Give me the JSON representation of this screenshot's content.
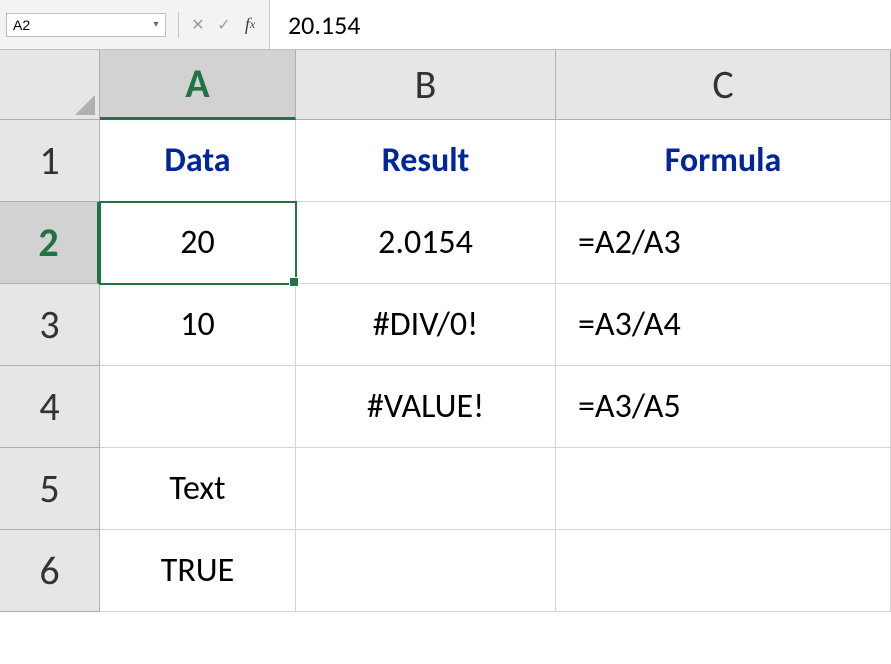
{
  "name_box": "A2",
  "formula_bar_value": "20.154",
  "columns": {
    "A": "A",
    "B": "B",
    "C": "C"
  },
  "rows": {
    "r1": "1",
    "r2": "2",
    "r3": "3",
    "r4": "4",
    "r5": "5",
    "r6": "6"
  },
  "cells": {
    "A1": "Data",
    "B1": "Result",
    "C1": "Formula",
    "A2": "20",
    "B2": "2.0154",
    "C2": "=A2/A3",
    "A3": "10",
    "B3": "#DIV/0!",
    "C3": "=A3/A4",
    "A4": "",
    "B4": "#VALUE!",
    "C4": "=A3/A5",
    "A5": "Text",
    "B5": "",
    "C5": "",
    "A6": "TRUE",
    "B6": "",
    "C6": ""
  },
  "selection": {
    "active_cell": "A2",
    "selected_column": "A",
    "selected_row": "2"
  }
}
